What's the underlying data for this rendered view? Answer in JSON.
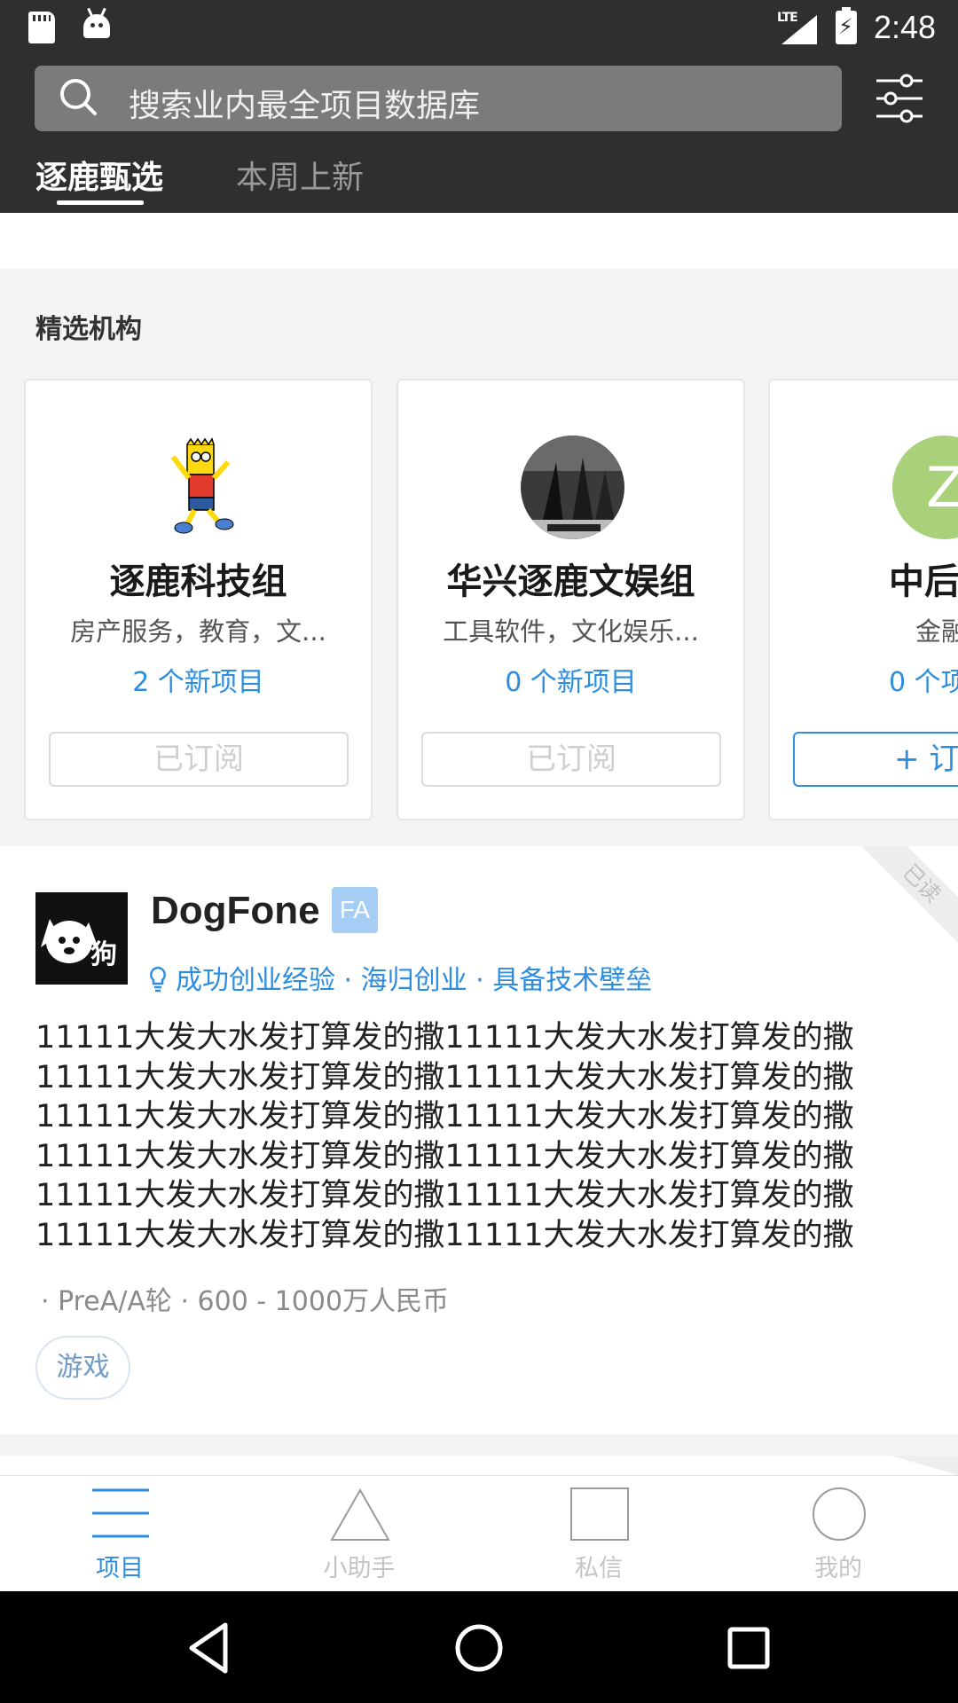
{
  "status_bar": {
    "network": "LTE",
    "time": "2:48"
  },
  "search": {
    "placeholder": "搜索业内最全项目数据库"
  },
  "tabs": [
    {
      "label": "逐鹿甄选",
      "active": true
    },
    {
      "label": "本周上新",
      "active": false
    }
  ],
  "featured": {
    "title": "精选机构",
    "orgs": [
      {
        "name": "逐鹿科技组",
        "tags": "房产服务，教育，文...",
        "new_projects": "2 个新项目",
        "button": "已订阅",
        "subscribed": true
      },
      {
        "name": "华兴逐鹿文娱组",
        "tags": "工具软件，文化娱乐...",
        "new_projects": "0 个新项目",
        "button": "已订阅",
        "subscribed": true
      },
      {
        "name": "中后",
        "tags": "金融",
        "new_projects": "0 个项",
        "button": "+ 订",
        "subscribed": false,
        "avatar_letter": "Z"
      }
    ]
  },
  "project": {
    "read_label": "已读",
    "name": "DogFone",
    "badge": "FA",
    "highlights": "成功创业经验 · 海归创业 · 具备技术壁垒",
    "description_lines": [
      "11111大发大水发打算发的撒11111大发大水发打算发的撒",
      "11111大发大水发打算发的撒11111大发大水发打算发的撒",
      "11111大发大水发打算发的撒11111大发大水发打算发的撒",
      "11111大发大水发打算发的撒11111大发大水发打算发的撒",
      "11111大发大水发打算发的撒11111大发大水发打算发的撒",
      "11111大发大水发打算发的撒11111大发大水发打算发的撒"
    ],
    "meta": "· PreA/A轮 · 600 - 1000万人民币",
    "tag": "游戏"
  },
  "bottom_nav": [
    {
      "label": "项目",
      "icon": "menu-icon",
      "active": true
    },
    {
      "label": "小助手",
      "icon": "triangle-icon",
      "active": false
    },
    {
      "label": "私信",
      "icon": "square-icon",
      "active": false
    },
    {
      "label": "我的",
      "icon": "circle-icon",
      "active": false
    }
  ],
  "colors": {
    "accent": "#2d8de0",
    "header_bg": "#2f2f2f",
    "badge_bg": "#a6cdf3"
  }
}
